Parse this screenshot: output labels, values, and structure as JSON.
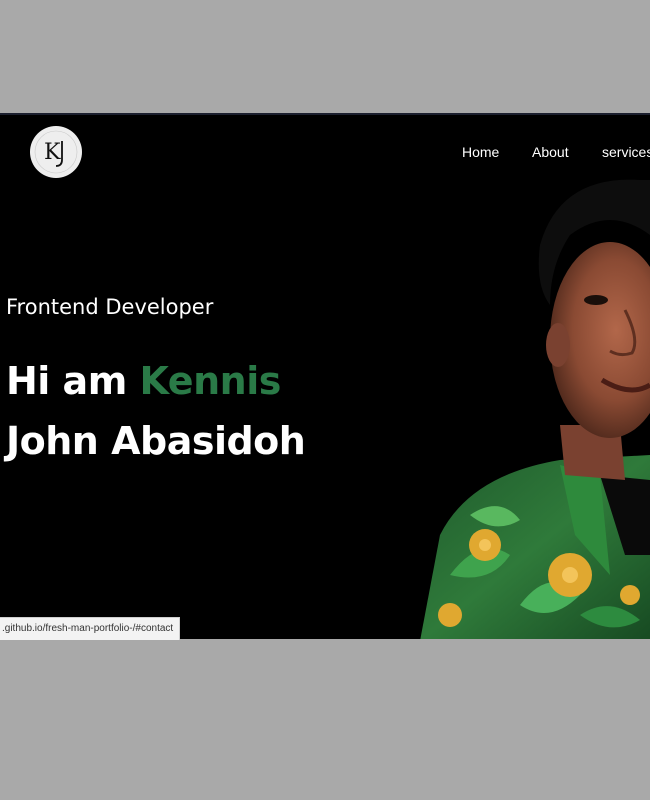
{
  "logo": {
    "monogram": "KJ",
    "icon": "kj-monogram-logo"
  },
  "nav": {
    "items": [
      {
        "label": "Home"
      },
      {
        "label": "About"
      },
      {
        "label": "services"
      }
    ]
  },
  "hero": {
    "subtitle": "Frontend Developer",
    "greeting": "Hi am ",
    "first_name": "Kennis",
    "last_line": "John Abasidoh",
    "accent_color": "#2a7a47"
  },
  "portrait": {
    "icon": "person-portrait"
  },
  "status_bar": {
    "url": ".github.io/fresh-man-portfolio-/#contact"
  }
}
